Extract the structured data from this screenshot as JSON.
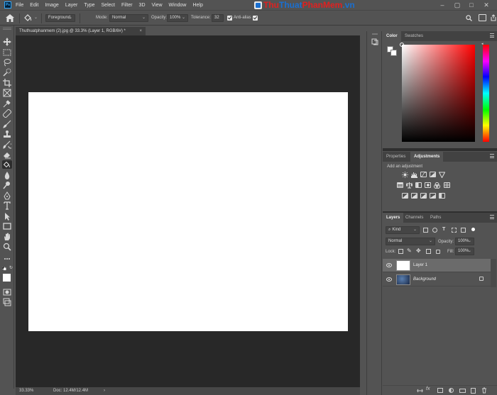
{
  "menu": {
    "items": [
      "File",
      "Edit",
      "Image",
      "Layer",
      "Type",
      "Select",
      "Filter",
      "3D",
      "View",
      "Window",
      "Help"
    ],
    "watermark": {
      "part1": "Thu",
      "part2": "Thuat",
      "part3": "PhanMem",
      "part4": ".vn"
    }
  },
  "options": {
    "fill_source": "Foreground",
    "mode_label": "Mode:",
    "mode_value": "Normal",
    "opacity_label": "Opacity:",
    "opacity_value": "100%",
    "tolerance_label": "Tolerance:",
    "tolerance_value": "32",
    "antialias_label": "Anti-alias"
  },
  "document": {
    "tab_title": "Thuthuatphanmem (2).jpg @ 33.3% (Layer 1, RGB/8#) *",
    "close": "×",
    "canvas_color": "#ffffff"
  },
  "status": {
    "zoom": "33.33%",
    "doc_info": "Doc: 12.4M/12.4M",
    "arrow": "›"
  },
  "color_panel": {
    "tabs": [
      "Color",
      "Swatches"
    ],
    "active_tab": "Color",
    "hue": "#ff0000"
  },
  "adjustments_panel": {
    "tabs": [
      "Properties",
      "Adjustments"
    ],
    "active_tab": "Adjustments",
    "heading": "Add an adjustment"
  },
  "layers_panel": {
    "tabs": [
      "Layers",
      "Channels",
      "Paths"
    ],
    "active_tab": "Layers",
    "filter_kind": "Kind",
    "blend_mode": "Normal",
    "opacity_label": "Opacity:",
    "opacity_value": "100%",
    "lock_label": "Lock:",
    "fill_label": "Fill:",
    "fill_value": "100%",
    "layers": [
      {
        "name": "Layer 1",
        "selected": true
      },
      {
        "name": "Background",
        "selected": false
      }
    ],
    "footer_fx": "fx"
  }
}
